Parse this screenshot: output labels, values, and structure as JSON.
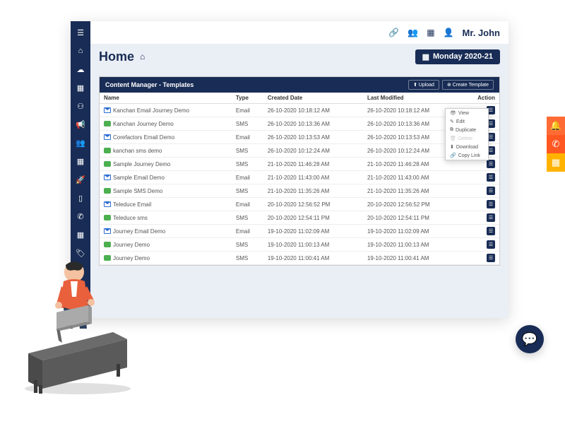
{
  "user": {
    "name": "Mr. John"
  },
  "breadcrumb": {
    "title": "Home"
  },
  "date_badge": {
    "text": "Monday 2020-21"
  },
  "panel": {
    "title": "Content Manager - Templates",
    "upload_label": "⬆ Upload",
    "create_label": "⊕ Create Template"
  },
  "columns": {
    "name": "Name",
    "type": "Type",
    "created": "Created Date ",
    "modified": "Last Modified",
    "action": "Action"
  },
  "rows": [
    {
      "icon": "email",
      "name": "Kanchan Email Journey Demo",
      "type": "Email",
      "created": "26-10-2020 10:18:12 AM",
      "modified": "26-10-2020 10:18:12 AM"
    },
    {
      "icon": "sms",
      "name": "Kanchan Journey Demo",
      "type": "SMS",
      "created": "26-10-2020 10:13:36 AM",
      "modified": "26-10-2020 10:13:36 AM"
    },
    {
      "icon": "email",
      "name": "Corefactors Email Demo",
      "type": "Email",
      "created": "26-10-2020 10:13:53 AM",
      "modified": "26-10-2020 10:13:53 AM"
    },
    {
      "icon": "sms",
      "name": "kanchan sms demo",
      "type": "SMS",
      "created": "26-10-2020 10:12:24 AM",
      "modified": "26-10-2020 10:12:24 AM"
    },
    {
      "icon": "sms",
      "name": "Sample Journey Demo",
      "type": "SMS",
      "created": "21-10-2020 11:46:28 AM",
      "modified": "21-10-2020 11:46:28 AM"
    },
    {
      "icon": "email",
      "name": "Sample Email Demo",
      "type": "Email",
      "created": "21-10-2020 11:43:00 AM",
      "modified": "21-10-2020 11:43:00 AM"
    },
    {
      "icon": "sms",
      "name": "Sample SMS Demo",
      "type": "SMS",
      "created": "21-10-2020 11:35:26 AM",
      "modified": "21-10-2020 11:35:26 AM"
    },
    {
      "icon": "email",
      "name": "Teleduce Email",
      "type": "Email",
      "created": "20-10-2020 12:56:52 PM",
      "modified": "20-10-2020 12:56:52 PM"
    },
    {
      "icon": "sms",
      "name": "Teleduce sms",
      "type": "SMS",
      "created": "20-10-2020 12:54:11 PM",
      "modified": "20-10-2020 12:54:11 PM"
    },
    {
      "icon": "email",
      "name": "Journey Email Demo",
      "type": "Email",
      "created": "19-10-2020 11:02:09 AM",
      "modified": "19-10-2020 11:02:09 AM"
    },
    {
      "icon": "sms",
      "name": "Journey Demo",
      "type": "SMS",
      "created": "19-10-2020 11:00:13 AM",
      "modified": "19-10-2020 11:00:13 AM"
    },
    {
      "icon": "sms",
      "name": "Journey Demo",
      "type": "SMS",
      "created": "19-10-2020 11:00:41 AM",
      "modified": "19-10-2020 11:00:41 AM"
    }
  ],
  "context_menu": {
    "view": "View",
    "edit": "Edit",
    "duplicate": "Duplicate",
    "delete": "Delete",
    "download": "Download",
    "copy_link": "Copy Link"
  }
}
